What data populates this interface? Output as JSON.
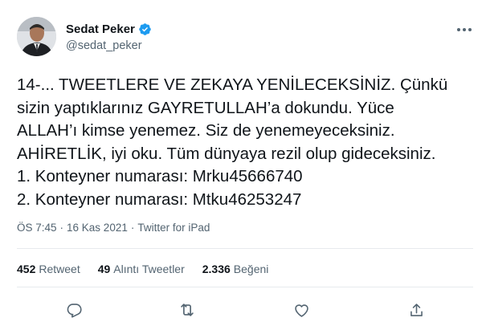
{
  "author": {
    "name": "Sedat Peker",
    "handle": "@sedat_peker"
  },
  "tweet": {
    "lines": [
      "14-... TWEETLERE VE ZEKAYA YENİLECEKSİNİZ. Çünkü",
      "sizin yaptıklarınız GAYRETULLAH’a dokundu. Yüce",
      "ALLAH’ı kimse yenemez. Siz de yenemeyeceksiniz.",
      "AHİRETLİK, iyi oku. Tüm dünyaya rezil olup gideceksiniz.",
      "1. Konteyner numarası: Mrku45666740",
      "2. Konteyner numarası: Mtku46253247"
    ],
    "time": "ÖS 7:45",
    "separator": "·",
    "date": "16 Kas 2021",
    "source": "Twitter for iPad"
  },
  "stats": {
    "retweets_count": "452",
    "retweets_label": "Retweet",
    "quotes_count": "49",
    "quotes_label": "Alıntı Tweetler",
    "likes_count": "2.336",
    "likes_label": "Beğeni"
  },
  "colors": {
    "verified": "#1d9bf0",
    "text": "#0f1419",
    "secondary": "#536471",
    "divider": "#e7eaee"
  },
  "icons": {
    "more": "more-dots-icon",
    "reply": "reply-icon",
    "retweet": "retweet-icon",
    "like": "heart-icon",
    "share": "share-icon",
    "verified": "verified-badge-icon"
  }
}
